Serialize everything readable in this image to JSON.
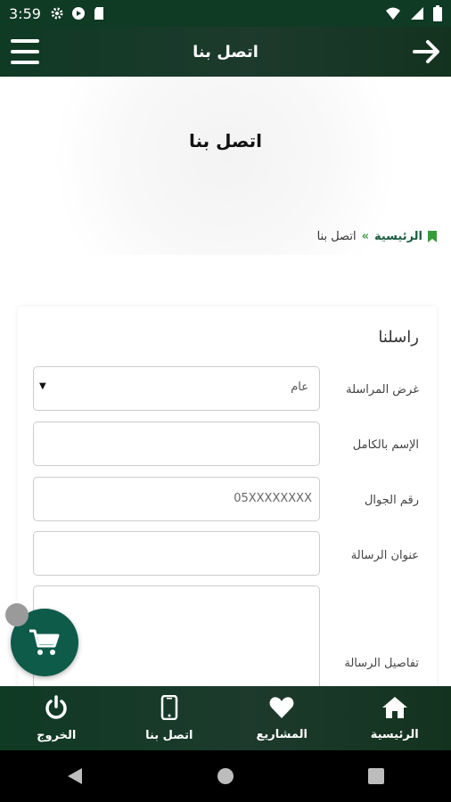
{
  "status_bar": {
    "time": "3:59"
  },
  "app_bar": {
    "title": "اتصل بنا"
  },
  "hero": {
    "title": "اتصل بنا"
  },
  "breadcrumb": {
    "home": "الرئيسية",
    "separator": "»",
    "current": "اتصل بنا"
  },
  "form": {
    "title": "راسلنا",
    "fields": [
      {
        "label": "غرض المراسلة",
        "type": "select",
        "value": "عام"
      },
      {
        "label": "الإسم بالكامل",
        "type": "text",
        "placeholder": ""
      },
      {
        "label": "رقم الجوال",
        "type": "text",
        "placeholder": "05XXXXXXXX"
      },
      {
        "label": "عنوان الرسالة",
        "type": "text",
        "placeholder": ""
      },
      {
        "label": "تفاصيل الرسالة",
        "type": "textarea",
        "placeholder": ""
      }
    ]
  },
  "bottom_nav": {
    "items": [
      {
        "label": "الرئيسية",
        "icon": "home-icon"
      },
      {
        "label": "المشاريع",
        "icon": "heart-icon"
      },
      {
        "label": "اتصل بنا",
        "icon": "phone-icon"
      },
      {
        "label": "الخروج",
        "icon": "power-icon"
      }
    ]
  },
  "colors": {
    "primary_dark": "#0f3a24",
    "accent_green": "#3a9a3a",
    "fab": "#0f5b4a"
  }
}
